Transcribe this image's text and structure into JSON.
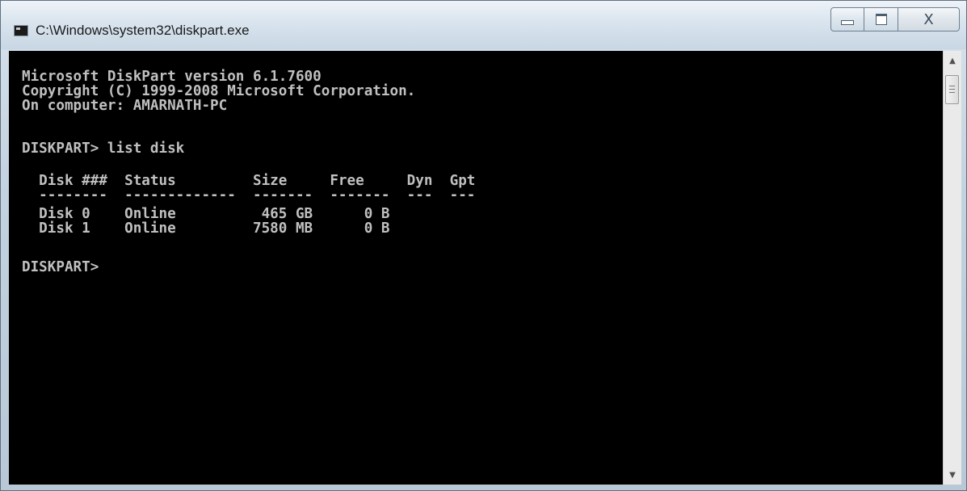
{
  "window": {
    "title": "C:\\Windows\\system32\\diskpart.exe",
    "close_glyph": "X"
  },
  "console": {
    "lines": [
      "Microsoft DiskPart version 6.1.7600",
      "Copyright (C) 1999-2008 Microsoft Corporation.",
      "On computer: AMARNATH-PC",
      "",
      "DISKPART> list disk",
      "",
      "  Disk ###  Status         Size     Free     Dyn  Gpt",
      "  --------  -------------  -------  -------  ---  ---",
      "  Disk 0    Online          465 GB      0 B",
      "  Disk 1    Online         7580 MB      0 B",
      "",
      "DISKPART>"
    ]
  },
  "icons": {
    "app": "console-app-icon",
    "minimize": "minimize-icon",
    "maximize": "maximize-icon",
    "close": "close-icon",
    "scroll_up": "scroll-up-arrow-icon",
    "scroll_down": "scroll-down-arrow-icon"
  },
  "colors": {
    "console_background": "#000000",
    "console_text": "#c0c0c0"
  }
}
